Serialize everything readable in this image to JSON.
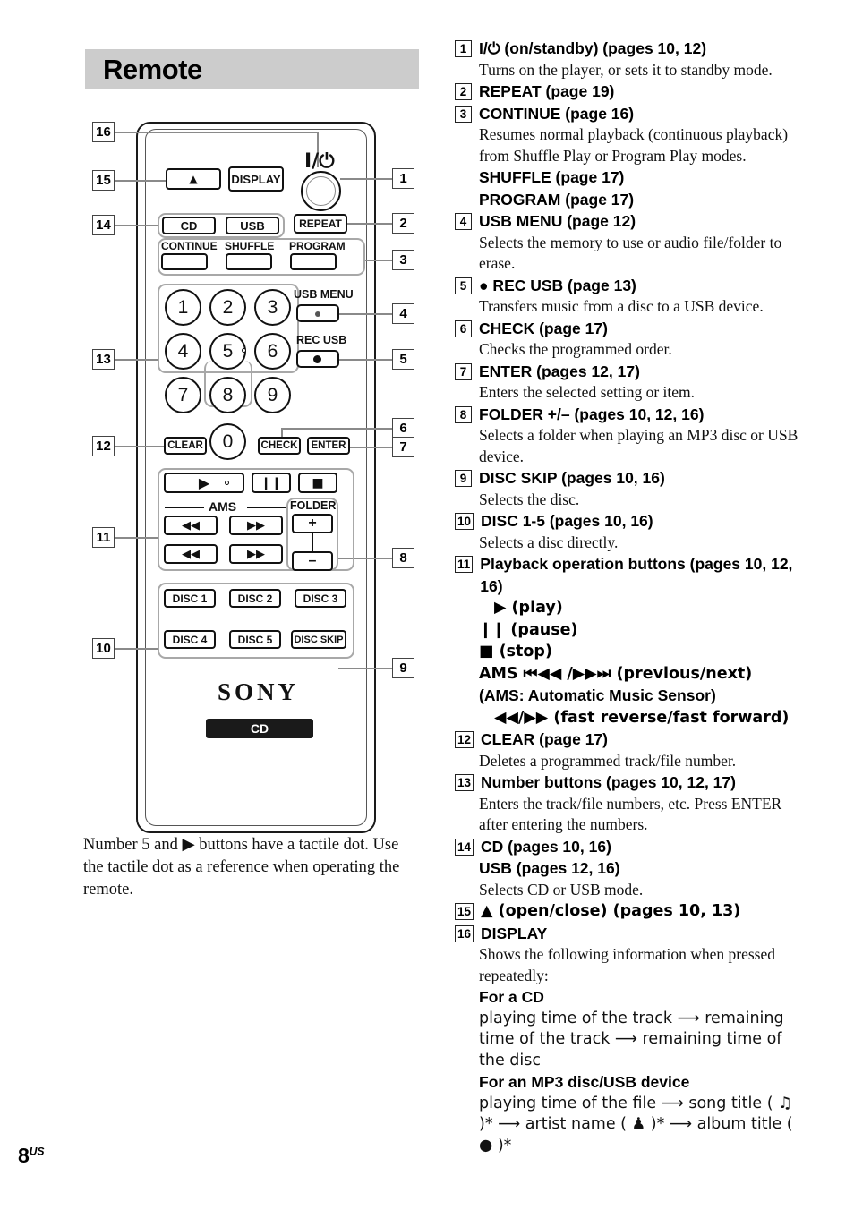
{
  "header": {
    "title": "Remote"
  },
  "page_number": {
    "num": "8",
    "suffix": "US"
  },
  "caption": "Number 5 and ▶ buttons have a tactile dot. Use the tactile dot as a reference when operating the remote.",
  "remote": {
    "brand": "SONY",
    "mode_badge": "CD",
    "buttons": {
      "eject": "▲",
      "display": "DISPLAY",
      "power_symbol": "I/⏻",
      "cd": "CD",
      "usb": "USB",
      "repeat": "REPEAT",
      "continue": "CONTINUE",
      "shuffle": "SHUFFLE",
      "program": "PROGRAM",
      "usb_menu": "USB MENU",
      "rec_usb": "REC USB",
      "clear": "CLEAR",
      "check": "CHECK",
      "enter": "ENTER",
      "ams": "AMS",
      "folder": "FOLDER",
      "folder_plus": "+",
      "folder_minus": "–",
      "disc1": "DISC 1",
      "disc2": "DISC 2",
      "disc3": "DISC 3",
      "disc4": "DISC 4",
      "disc5": "DISC 5",
      "disc_skip": "DISC SKIP",
      "play": "▶",
      "pause": "❙❙",
      "stop": "■",
      "prev": "◀◀",
      "next": "▶▶",
      "frev": "◀◀",
      "ffwd": "▶▶"
    },
    "number_keys": [
      "1",
      "2",
      "3",
      "4",
      "5",
      "6",
      "7",
      "8",
      "9",
      "0"
    ],
    "callouts_left": [
      "16",
      "15",
      "14",
      "13",
      "12",
      "11",
      "10"
    ],
    "callouts_right": [
      "1",
      "2",
      "3",
      "4",
      "5",
      "6",
      "7",
      "8",
      "9"
    ]
  },
  "legend": [
    {
      "num": "1",
      "head": "I/⏻ (on/standby) (pages 10, 12)",
      "lines": [
        {
          "type": "body",
          "text": "Turns on the player, or sets it to standby mode."
        }
      ]
    },
    {
      "num": "2",
      "head": "REPEAT (page 19)",
      "lines": []
    },
    {
      "num": "3",
      "head": "CONTINUE (page 16)",
      "lines": [
        {
          "type": "body",
          "text": "Resumes normal playback (continuous playback) from Shuffle Play or Program Play modes."
        },
        {
          "type": "sub",
          "text": "SHUFFLE (page 17)"
        },
        {
          "type": "sub",
          "text": "PROGRAM (page 17)"
        }
      ]
    },
    {
      "num": "4",
      "head": "USB MENU (page 12)",
      "lines": [
        {
          "type": "body",
          "text": "Selects the memory to use or audio file/folder to erase."
        }
      ]
    },
    {
      "num": "5",
      "head": "● REC USB (page 13)",
      "lines": [
        {
          "type": "body",
          "text": "Transfers music from a disc to a USB device."
        }
      ]
    },
    {
      "num": "6",
      "head": "CHECK (page 17)",
      "lines": [
        {
          "type": "body",
          "text": "Checks the programmed order."
        }
      ]
    },
    {
      "num": "7",
      "head": "ENTER (pages 12, 17)",
      "lines": [
        {
          "type": "body",
          "text": "Enters the selected setting or item."
        }
      ]
    },
    {
      "num": "8",
      "head": "FOLDER +/– (pages 10, 12, 16)",
      "lines": [
        {
          "type": "body",
          "text": "Selects a folder when playing an MP3 disc or USB device."
        }
      ]
    },
    {
      "num": "9",
      "head": "DISC SKIP (pages 10, 16)",
      "lines": [
        {
          "type": "body",
          "text": "Selects the disc."
        }
      ]
    },
    {
      "num": "10",
      "head": "DISC 1-5 (pages 10, 16)",
      "lines": [
        {
          "type": "body",
          "text": "Selects a disc directly."
        }
      ]
    },
    {
      "num": "11",
      "head": "Playback operation buttons (pages 10, 12, 16)",
      "lines": [
        {
          "type": "sub-ind",
          "text": "▶ (play)"
        },
        {
          "type": "sub",
          "text": "❙❙ (pause)"
        },
        {
          "type": "sub",
          "text": "■ (stop)"
        },
        {
          "type": "sub",
          "text": "AMS ⏮◀◀ /▶▶⏭ (previous/next)"
        },
        {
          "type": "sub",
          "text": "(AMS: Automatic Music Sensor)"
        },
        {
          "type": "sub-ind",
          "text": "◀◀/▶▶ (fast reverse/fast forward)"
        }
      ]
    },
    {
      "num": "12",
      "head": "CLEAR (page 17)",
      "lines": [
        {
          "type": "body",
          "text": "Deletes a programmed track/file number."
        }
      ]
    },
    {
      "num": "13",
      "head": "Number buttons (pages 10, 12, 17)",
      "lines": [
        {
          "type": "body",
          "text": "Enters the track/file numbers, etc. Press ENTER after entering the numbers."
        }
      ]
    },
    {
      "num": "14",
      "head": "CD (pages 10, 16)",
      "lines": [
        {
          "type": "sub",
          "text": "USB (pages 12, 16)"
        },
        {
          "type": "body",
          "text": "Selects CD or USB mode."
        }
      ]
    },
    {
      "num": "15",
      "head": "▲ (open/close) (pages 10, 13)",
      "lines": []
    },
    {
      "num": "16",
      "head": "DISPLAY",
      "lines": [
        {
          "type": "body",
          "text": "Shows the following information when pressed repeatedly:"
        },
        {
          "type": "sub",
          "text": "For a CD"
        },
        {
          "type": "body",
          "text": "playing time of the track ⟶ remaining time of the track ⟶ remaining time of the disc"
        },
        {
          "type": "sub",
          "text": "For an MP3 disc/USB device"
        },
        {
          "type": "body",
          "text": "playing time of the file ⟶ song title ( ♫ )* ⟶ artist name ( ♟ )* ⟶ album title ( ● )*"
        }
      ]
    }
  ]
}
